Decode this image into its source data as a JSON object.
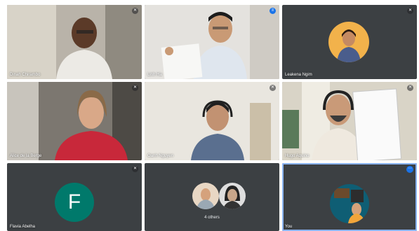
{
  "tiles": [
    {
      "name": "Dinah Chirambo",
      "muted": true
    },
    {
      "name": "Linh Ha",
      "speaking": true
    },
    {
      "name": "Leakena Ngim",
      "muted": true
    },
    {
      "name": "Alice de la Berge",
      "muted": true
    },
    {
      "name": "Oanh Nguyen",
      "muted": true
    },
    {
      "name": "Hugo Aquino",
      "muted": true
    },
    {
      "name": "Flavia Abelha",
      "initial": "F",
      "muted": true
    },
    {
      "others_label": "4 others"
    },
    {
      "name": "You",
      "muted": false
    }
  ],
  "icons": {
    "mic_off": "mic-off-icon",
    "speaking": "speaking-icon",
    "more": "more-options-icon"
  },
  "colors": {
    "tile_bg": "#3c4043",
    "accent": "#1a73e8",
    "avatar_teal": "#00796b"
  }
}
